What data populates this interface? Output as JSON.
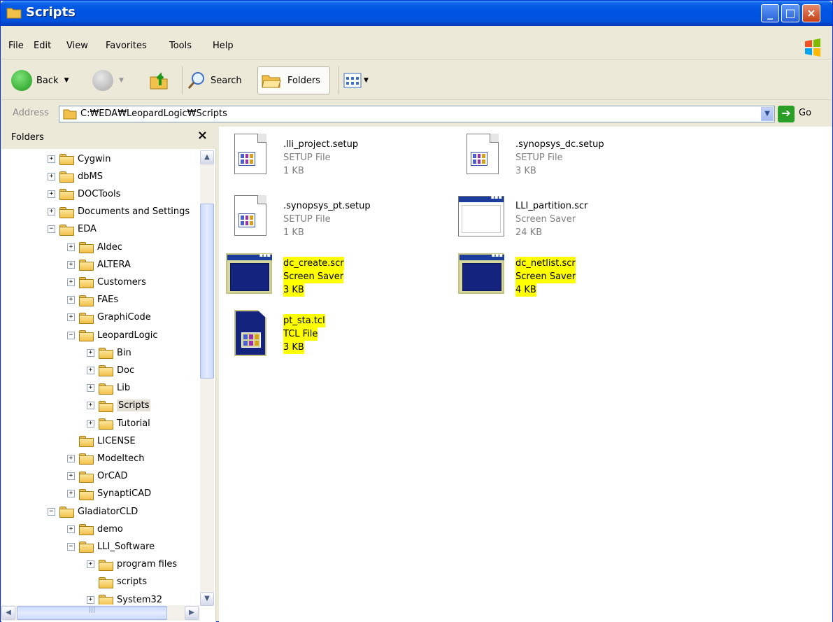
{
  "window": {
    "title": "Scripts",
    "accent": "#0054e3",
    "highlight": "#ffff00"
  },
  "menu": [
    "File",
    "Edit",
    "View",
    "Favorites",
    "Tools",
    "Help"
  ],
  "toolbar": {
    "back": "Back",
    "search": "Search",
    "folders": "Folders"
  },
  "address": {
    "label": "Address",
    "value": "C:₩EDA₩LeopardLogic₩Scripts",
    "go": "Go"
  },
  "folders_pane": {
    "title": "Folders",
    "close": "×",
    "tree": [
      {
        "label": "Cygwin",
        "level": 0,
        "expander": "+"
      },
      {
        "label": "dbMS",
        "level": 0,
        "expander": "+"
      },
      {
        "label": "DOCTools",
        "level": 0,
        "expander": "+"
      },
      {
        "label": "Documents and Settings",
        "level": 0,
        "expander": "+"
      },
      {
        "label": "EDA",
        "level": 0,
        "expander": "−"
      },
      {
        "label": "Aldec",
        "level": 1,
        "expander": "+"
      },
      {
        "label": "ALTERA",
        "level": 1,
        "expander": "+"
      },
      {
        "label": "Customers",
        "level": 1,
        "expander": "+"
      },
      {
        "label": "FAEs",
        "level": 1,
        "expander": "+"
      },
      {
        "label": "GraphiCode",
        "level": 1,
        "expander": "+"
      },
      {
        "label": "LeopardLogic",
        "level": 1,
        "expander": "−"
      },
      {
        "label": "Bin",
        "level": 2,
        "expander": "+"
      },
      {
        "label": "Doc",
        "level": 2,
        "expander": "+"
      },
      {
        "label": "Lib",
        "level": 2,
        "expander": "+"
      },
      {
        "label": "Scripts",
        "level": 2,
        "expander": "+",
        "selected": true
      },
      {
        "label": "Tutorial",
        "level": 2,
        "expander": "+"
      },
      {
        "label": "LICENSE",
        "level": 1,
        "expander": ""
      },
      {
        "label": "Modeltech",
        "level": 1,
        "expander": "+"
      },
      {
        "label": "OrCAD",
        "level": 1,
        "expander": "+"
      },
      {
        "label": "SynaptiCAD",
        "level": 1,
        "expander": "+"
      },
      {
        "label": "GladiatorCLD",
        "level": 0,
        "expander": "−"
      },
      {
        "label": "demo",
        "level": 1,
        "expander": "+"
      },
      {
        "label": "LLI_Software",
        "level": 1,
        "expander": "−"
      },
      {
        "label": "program files",
        "level": 2,
        "expander": "+"
      },
      {
        "label": "scripts",
        "level": 2,
        "expander": ""
      },
      {
        "label": "System32",
        "level": 2,
        "expander": "+"
      }
    ]
  },
  "files": [
    {
      "name": ".lli_project.setup",
      "type": "SETUP File",
      "size": "1 KB",
      "icon": "setup-file-icon",
      "highlighted": false
    },
    {
      "name": ".synopsys_dc.setup",
      "type": "SETUP File",
      "size": "3 KB",
      "icon": "setup-file-icon",
      "highlighted": false
    },
    {
      "name": ".synopsys_pt.setup",
      "type": "SETUP File",
      "size": "1 KB",
      "icon": "setup-file-icon",
      "highlighted": false
    },
    {
      "name": "LLI_partition.scr",
      "type": "Screen Saver",
      "size": "24 KB",
      "icon": "screen-saver-icon",
      "highlighted": false
    },
    {
      "name": "dc_create.scr",
      "type": "Screen Saver",
      "size": "3 KB",
      "icon": "screen-saver-icon",
      "highlighted": true
    },
    {
      "name": "dc_netlist.scr",
      "type": "Screen Saver",
      "size": "4 KB",
      "icon": "screen-saver-icon",
      "highlighted": true
    },
    {
      "name": "pt_sta.tcl",
      "type": "TCL File",
      "size": "3 KB",
      "icon": "tcl-file-icon",
      "highlighted": true
    }
  ]
}
